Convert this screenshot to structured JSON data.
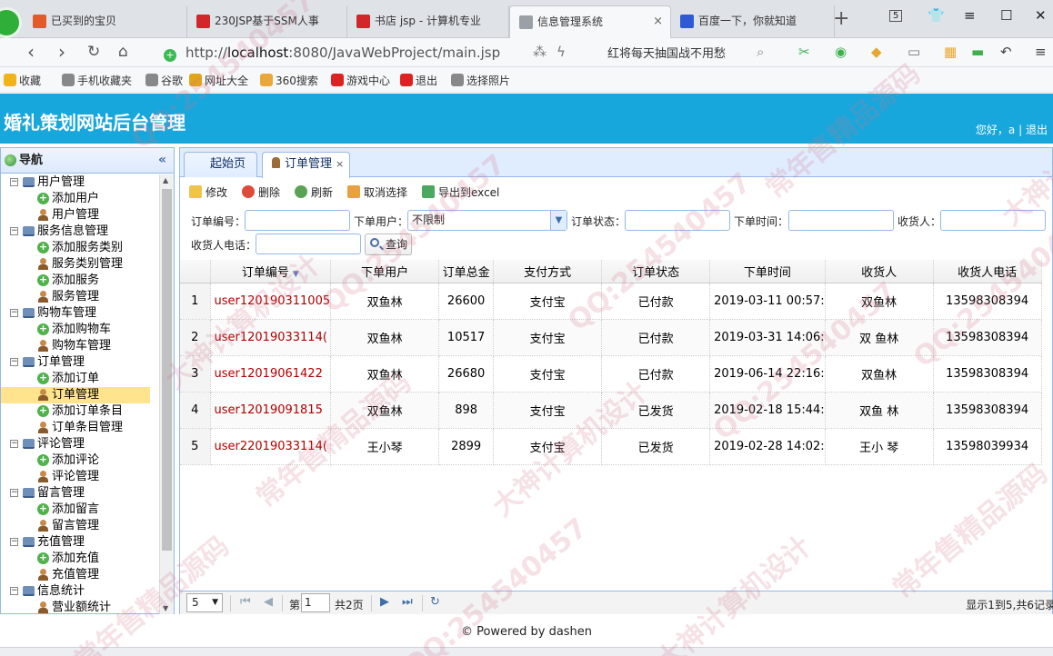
{
  "browser": {
    "tabs": [
      {
        "label": "已买到的宝贝",
        "fav": "#e35b2a"
      },
      {
        "label": "230JSP基于SSM人事",
        "fav": "#d3262b"
      },
      {
        "label": "书店 jsp - 计算机专业",
        "fav": "#d3262b"
      },
      {
        "label": "信息管理系统",
        "fav": "#9aa0a6"
      },
      {
        "label": "百度一下，你就知道",
        "fav": "#2e5bd3"
      }
    ],
    "new_tab": "+",
    "tab_count": "5",
    "url_prefix": "http://",
    "url_host": "localhost",
    "url_rest": ":8080/JavaWebProject/main.jsp",
    "promo": "红将每天抽国战不用愁",
    "bookmarks": [
      "收藏",
      "手机收藏夹",
      "谷歌",
      "网址大全",
      "360搜索",
      "游戏中心",
      "退出",
      "选择照片"
    ]
  },
  "app": {
    "title": "婚礼策划网站后台管理",
    "welcome": "您好，a",
    "logout": "退出",
    "separator": "|"
  },
  "nav": {
    "title": "导航",
    "collapse": "«",
    "groups": [
      {
        "label": "用户管理",
        "items": [
          "添加用户",
          "用户管理"
        ]
      },
      {
        "label": "服务信息管理",
        "items": [
          "添加服务类别",
          "服务类别管理",
          "添加服务",
          "服务管理"
        ]
      },
      {
        "label": "购物车管理",
        "items": [
          "添加购物车",
          "购物车管理"
        ]
      },
      {
        "label": "订单管理",
        "items": [
          "添加订单",
          "订单管理",
          "添加订单条目",
          "订单条目管理"
        ]
      },
      {
        "label": "评论管理",
        "items": [
          "添加评论",
          "评论管理"
        ]
      },
      {
        "label": "留言管理",
        "items": [
          "添加留言",
          "留言管理"
        ]
      },
      {
        "label": "充值管理",
        "items": [
          "添加充值",
          "充值管理"
        ]
      },
      {
        "label": "信息统计",
        "items": [
          "营业额统计"
        ]
      }
    ],
    "selected": "订单管理"
  },
  "panel_tabs": [
    {
      "label": "起始页"
    },
    {
      "label": "订单管理",
      "close": "×"
    }
  ],
  "toolbar": {
    "edit": "修改",
    "delete": "删除",
    "refresh": "刷新",
    "cancel_select": "取消选择",
    "export": "导出到excel"
  },
  "filters": {
    "order_no": "订单编号：",
    "user": "下单用户：",
    "user_value": "不限制",
    "status": "订单状态：",
    "time": "下单时间：",
    "receiver": "收货人：",
    "phone": "收货人电话：",
    "query": "查询"
  },
  "grid": {
    "columns": [
      "订单编号",
      "下单用户",
      "订单总金",
      "支付方式",
      "订单状态",
      "下单时间",
      "收货人",
      "收货人电话"
    ],
    "rows": [
      {
        "n": "1",
        "id": "user120190311005",
        "user": "双鱼林",
        "total": "26600",
        "pay": "支付宝",
        "status": "已付款",
        "time": "2019-03-11 00:57:",
        "recv": "双鱼林",
        "phone": "13598308394"
      },
      {
        "n": "2",
        "id": "user12019033114(",
        "user": "双鱼林",
        "total": "10517",
        "pay": "支付宝",
        "status": "已付款",
        "time": "2019-03-31 14:06:",
        "recv": "双 鱼林",
        "phone": "13598308394"
      },
      {
        "n": "3",
        "id": "user12019061422",
        "user": "双鱼林",
        "total": "26680",
        "pay": "支付宝",
        "status": "已付款",
        "time": "2019-06-14 22:16:",
        "recv": "双鱼林",
        "phone": "13598308394"
      },
      {
        "n": "4",
        "id": "user12019091815",
        "user": "双鱼林",
        "total": "898",
        "pay": "支付宝",
        "status": "已发货",
        "time": "2019-02-18 15:44:",
        "recv": "双鱼 林",
        "phone": "13598308394"
      },
      {
        "n": "5",
        "id": "user22019033114(",
        "user": "王小琴",
        "total": "2899",
        "pay": "支付宝",
        "status": "已发货",
        "time": "2019-02-28 14:02:",
        "recv": "王小 琴",
        "phone": "13598039934"
      }
    ]
  },
  "pager": {
    "page_size": "5",
    "page_prefix": "第",
    "page": "1",
    "page_suffix": "共2页",
    "info": "显示1到5,共6记录"
  },
  "footer": "© Powered by dashen",
  "watermarks": [
    "QQ:254540457",
    "常年售精品源码",
    "大神计算机设计"
  ]
}
